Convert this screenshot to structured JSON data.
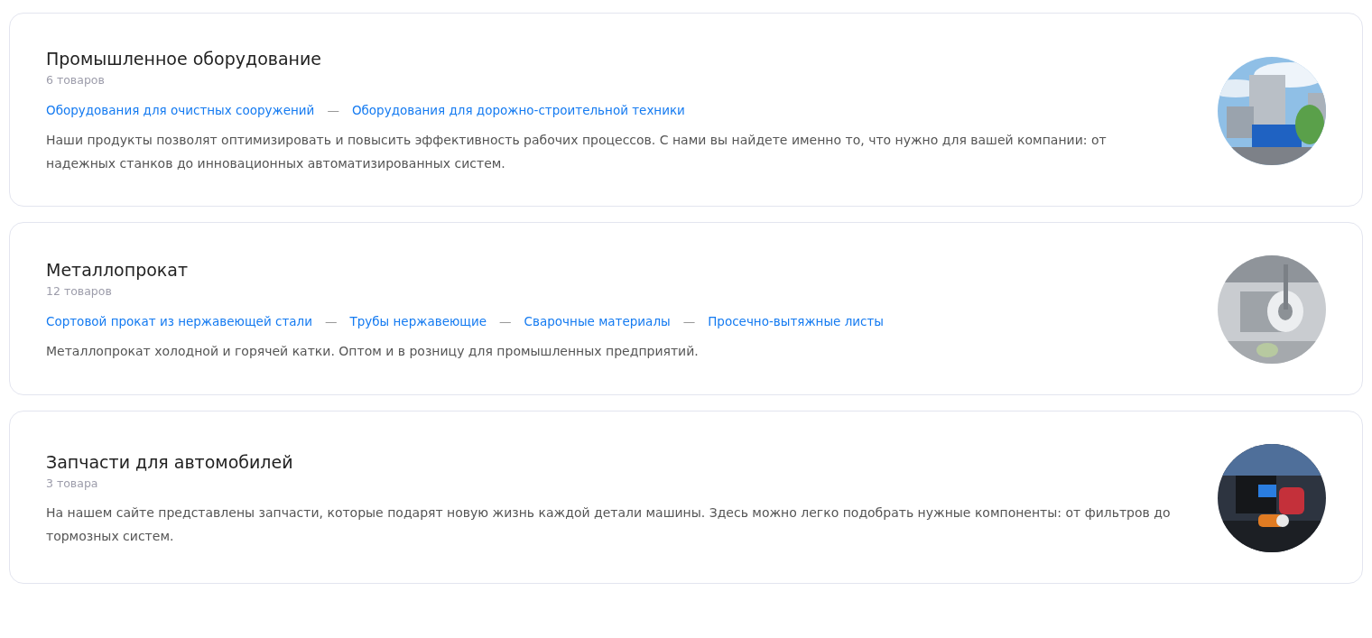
{
  "categories": [
    {
      "title": "Промышленное оборудование",
      "count": "6 товаров",
      "links": [
        "Оборудования для очистных сооружений",
        "Оборудования для дорожно-строительной техники"
      ],
      "separator": "—",
      "description": "Наши продукты позволят оптимизировать и повысить эффективность рабочих процессов. С нами вы найдете именно то, что нужно для вашей компании: от надежных станков до инновационных автоматизированных систем.",
      "image": {
        "kind": "picture"
      }
    },
    {
      "title": "Металлопрокат",
      "count": "12 товаров",
      "links": [
        "Сортовой прокат из нержавеющей стали",
        "Трубы нержавеющие",
        "Сварочные материалы",
        "Просечно-вытяжные листы"
      ],
      "separator": "—",
      "description": "Металлопрокат холодной и горячей катки. Оптом и в розницу для промышленных предприятий.",
      "image": {
        "kind": "picture"
      }
    },
    {
      "title": "Запчасти для автомобилей",
      "count": "3 товара",
      "description": "На нашем сайте представлены запчасти, которые подарят новую жизнь каждой детали машины. Здесь можно легко подобрать нужные компоненты: от фильтров до тормозных систем.",
      "image": {
        "kind": "picture"
      }
    }
  ]
}
